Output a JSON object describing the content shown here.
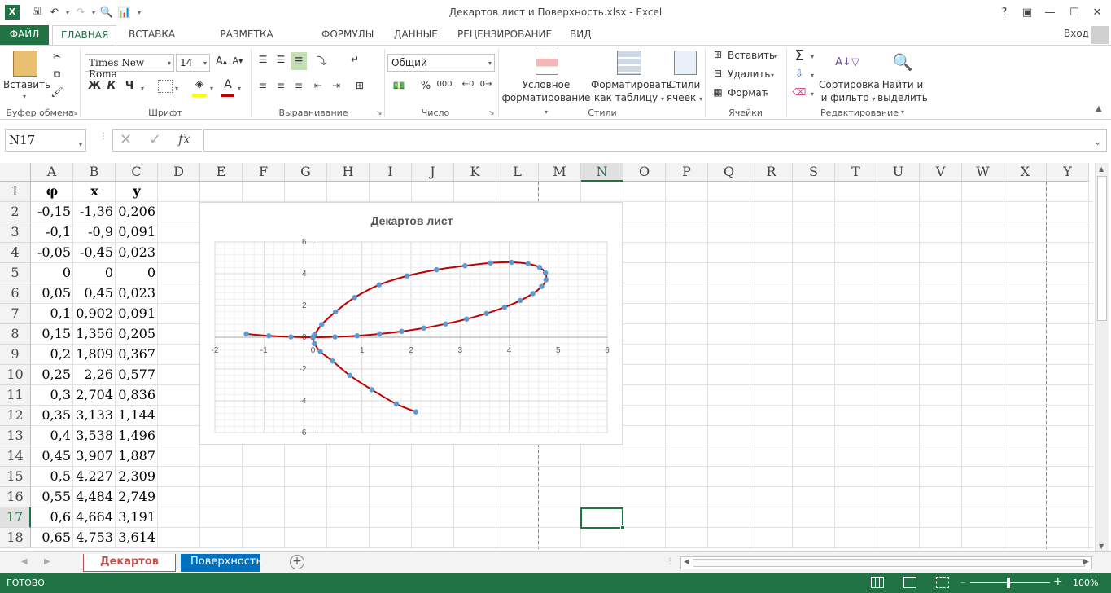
{
  "window": {
    "title": "Декартов лист и Поверхность.xlsx - Excel",
    "help": "?",
    "signin": "Вход"
  },
  "tabs": [
    {
      "label": "ФАЙЛ"
    },
    {
      "label": "ГЛАВНАЯ"
    },
    {
      "label": "ВСТАВКА"
    },
    {
      "label": "РАЗМЕТКА СТРАНИЦЫ"
    },
    {
      "label": "ФОРМУЛЫ"
    },
    {
      "label": "ДАННЫЕ"
    },
    {
      "label": "РЕЦЕНЗИРОВАНИЕ"
    },
    {
      "label": "ВИД"
    }
  ],
  "ribbon": {
    "clipboard": {
      "paste": "Вставить",
      "group": "Буфер обмена"
    },
    "font": {
      "name": "Times New Roma",
      "size": "14",
      "bold": "Ж",
      "italic": "К",
      "underline": "Ч",
      "group": "Шрифт",
      "font_color": "#c00000",
      "fill_color": "#ffff00"
    },
    "alignment": {
      "group": "Выравнивание"
    },
    "number": {
      "format": "Общий",
      "group": "Число",
      "percent": "%",
      "thousands": "000"
    },
    "styles": {
      "conditional1": "Условное",
      "conditional2": "форматирование",
      "table1": "Форматировать",
      "table2": "как таблицу",
      "cell1": "Стили",
      "cell2": "ячеек",
      "group": "Стили"
    },
    "cells": {
      "insert": "Вставить",
      "delete": "Удалить",
      "format": "Формат",
      "group": "Ячейки"
    },
    "editing": {
      "sort1": "Сортировка",
      "sort2": "и фильтр",
      "find1": "Найти и",
      "find2": "выделить",
      "group": "Редактирование"
    }
  },
  "formula_bar": {
    "name_box": "N17",
    "fx": "fx",
    "value": ""
  },
  "columns": [
    "A",
    "B",
    "C",
    "D",
    "E",
    "F",
    "G",
    "H",
    "I",
    "J",
    "K",
    "L",
    "M",
    "N",
    "O",
    "P",
    "Q",
    "R",
    "S",
    "T",
    "U",
    "V",
    "W",
    "X",
    "Y"
  ],
  "selected_column": "N",
  "rows": [
    {
      "n": "1",
      "a": "φ",
      "b": "x",
      "c": "y"
    },
    {
      "n": "2",
      "a": "-0,15",
      "b": "-1,36",
      "c": "0,206"
    },
    {
      "n": "3",
      "a": "-0,1",
      "b": "-0,9",
      "c": "0,091"
    },
    {
      "n": "4",
      "a": "-0,05",
      "b": "-0,45",
      "c": "0,023"
    },
    {
      "n": "5",
      "a": "0",
      "b": "0",
      "c": "0"
    },
    {
      "n": "6",
      "a": "0,05",
      "b": "0,45",
      "c": "0,023"
    },
    {
      "n": "7",
      "a": "0,1",
      "b": "0,902",
      "c": "0,091"
    },
    {
      "n": "8",
      "a": "0,15",
      "b": "1,356",
      "c": "0,205"
    },
    {
      "n": "9",
      "a": "0,2",
      "b": "1,809",
      "c": "0,367"
    },
    {
      "n": "10",
      "a": "0,25",
      "b": "2,26",
      "c": "0,577"
    },
    {
      "n": "11",
      "a": "0,3",
      "b": "2,704",
      "c": "0,836"
    },
    {
      "n": "12",
      "a": "0,35",
      "b": "3,133",
      "c": "1,144"
    },
    {
      "n": "13",
      "a": "0,4",
      "b": "3,538",
      "c": "1,496"
    },
    {
      "n": "14",
      "a": "0,45",
      "b": "3,907",
      "c": "1,887"
    },
    {
      "n": "15",
      "a": "0,5",
      "b": "4,227",
      "c": "2,309"
    },
    {
      "n": "16",
      "a": "0,55",
      "b": "4,484",
      "c": "2,749"
    },
    {
      "n": "17",
      "a": "0,6",
      "b": "4,664",
      "c": "3,191"
    },
    {
      "n": "18",
      "a": "0,65",
      "b": "4,753",
      "c": "3,614"
    }
  ],
  "selected_row": "17",
  "chart_data": {
    "type": "scatter",
    "title": "Декартов лист",
    "xlabel": "",
    "ylabel": "",
    "xlim": [
      -2,
      6
    ],
    "ylim": [
      -6,
      6
    ],
    "xticks": [
      "-2",
      "-1",
      "0",
      "1",
      "2",
      "3",
      "4",
      "5",
      "6"
    ],
    "yticks": [
      "-6",
      "-4",
      "-2",
      "0",
      "2",
      "4",
      "6"
    ],
    "grid": true,
    "line_color": "#c00000",
    "marker_color": "#5b9bd5",
    "series": [
      {
        "x": [
          -1.36,
          -0.9,
          -0.45,
          0,
          0.45,
          0.902,
          1.356,
          1.809,
          2.26,
          2.704,
          3.133,
          3.538,
          3.907,
          4.227,
          4.484,
          4.664,
          4.753,
          4.74,
          4.62,
          4.39,
          4.05,
          3.62,
          3.1,
          2.52,
          1.92,
          1.35,
          0.85,
          0.46,
          0.18,
          0.03,
          0,
          0.03,
          0.15,
          0.4,
          0.75,
          1.2,
          1.7,
          2.1
        ],
        "y": [
          0.206,
          0.091,
          0.023,
          0,
          0.023,
          0.091,
          0.205,
          0.367,
          0.577,
          0.836,
          1.144,
          1.496,
          1.887,
          2.309,
          2.749,
          3.191,
          3.614,
          4.05,
          4.4,
          4.62,
          4.72,
          4.68,
          4.5,
          4.25,
          3.86,
          3.3,
          2.5,
          1.6,
          0.8,
          0.15,
          -0.05,
          -0.4,
          -0.9,
          -1.5,
          -2.4,
          -3.3,
          -4.2,
          -4.7
        ]
      }
    ]
  },
  "sheets": [
    {
      "label": "Декартов лист",
      "active": true
    },
    {
      "label": "Поверхность",
      "active": false
    }
  ],
  "status": {
    "ready": "ГОТОВО",
    "zoom": "100%"
  }
}
